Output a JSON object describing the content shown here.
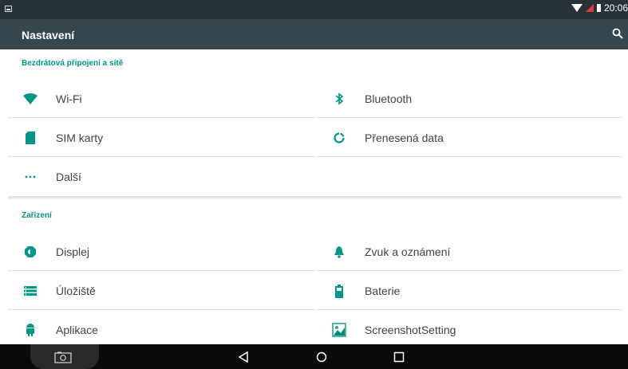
{
  "statusbar": {
    "time": "20:06"
  },
  "toolbar": {
    "title": "Nastavení",
    "search_icon": "search-icon"
  },
  "sections": [
    {
      "title": "Bezdrátová připojení a sítě"
    },
    {
      "title": "Zařízení"
    }
  ],
  "wireless": {
    "wifi": "Wi-Fi",
    "bluetooth": "Bluetooth",
    "sim": "SIM karty",
    "data": "Přenesená data",
    "more": "Další"
  },
  "device": {
    "display": "Displej",
    "sound": "Zvuk a oznámení",
    "storage": "Úložiště",
    "battery": "Baterie",
    "apps": "Aplikace",
    "screenshot": "ScreenshotSetting"
  },
  "colors": {
    "accent": "#009688",
    "toolbar": "#37474f",
    "statusbar": "#263238"
  }
}
